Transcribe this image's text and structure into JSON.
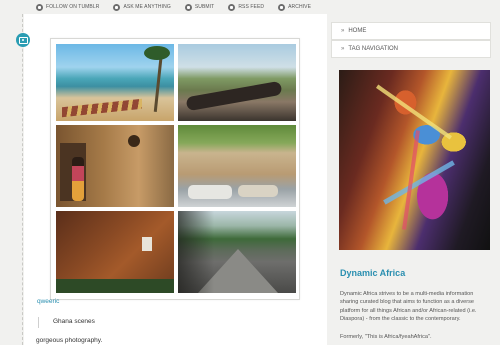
{
  "topnav": {
    "items": [
      {
        "label": "FOLLOW ON TUMBLR",
        "icon": "tumblr-icon"
      },
      {
        "label": "ASK ME ANYTHING",
        "icon": "question-icon"
      },
      {
        "label": "SUBMIT",
        "icon": "submit-icon"
      },
      {
        "label": "RSS FEED",
        "icon": "rss-icon"
      },
      {
        "label": "ARCHIVE",
        "icon": "archive-icon"
      }
    ]
  },
  "post": {
    "type_icon": "camera-icon",
    "photos": [
      "beach-with-boats-photo",
      "cannon-overlook-photo",
      "woman-by-wall-photo",
      "graffiti-wall-cars-photo",
      "red-clay-building-photo",
      "road-blur-photo"
    ],
    "user": "qweeric",
    "caption_title": "Ghana scenes",
    "caption_body": "gorgeous photography."
  },
  "sidebar": {
    "nav": [
      {
        "label": "HOME"
      },
      {
        "label": "TAG NAVIGATION"
      }
    ],
    "avatar": "abstract-painting-avatar",
    "blog_title": "Dynamic Africa",
    "description": "Dynamic Africa strives to be a multi-media information sharing curated blog that aims to function as a diverse platform for all things African and/or African-related (i.e. Diaspora) - from the classic to the contemporary.",
    "formerly": "Formerly, \"This is Africa/fyeahAfrica\"."
  },
  "colors": {
    "accent": "#2a8fb0",
    "background": "#f1f1ef",
    "panel": "#ffffff"
  }
}
